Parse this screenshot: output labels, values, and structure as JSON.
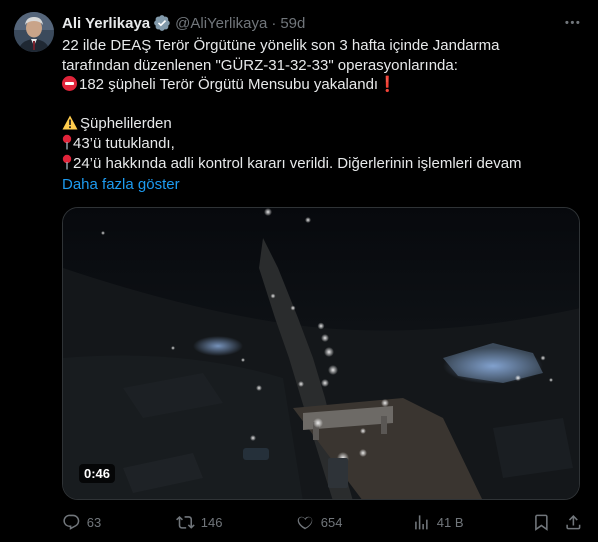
{
  "author": {
    "name": "Ali Yerlikaya",
    "handle": "@AliYerlikaya",
    "separator": "·",
    "time": "59d"
  },
  "tweet": {
    "line1": "22 ilde DEAŞ Terör Örgütüne yönelik son 3 hafta içinde Jandarma",
    "line2": "tarafından düzenlenen \"GÜRZ-31-32-33\" operasyonlarında:",
    "line3": "182 şüpheli Terör Örgütü Mensubu yakalandı",
    "line3_end": "❗",
    "line5": "Şüphelilerden",
    "line6": "43’ü tutuklandı,",
    "line7": "24’ü hakkında adli kontrol kararı verildi. Diğerlerinin işlemleri devam",
    "show_more": "Daha fazla göster"
  },
  "media": {
    "duration": "0:46"
  },
  "actions": {
    "replies": "63",
    "reposts": "146",
    "likes": "654",
    "views": "41 B"
  },
  "colors": {
    "background": "#000000",
    "text": "#e7e9ea",
    "muted": "#71767b",
    "link": "#1d9bf0",
    "verified": "#829aab",
    "border": "#2f3336"
  },
  "icons": [
    "avatar",
    "verified-badge-icon",
    "more-options-icon",
    "no-entry-emoji",
    "warning-emoji",
    "pin-emoji",
    "reply-icon",
    "repost-icon",
    "like-icon",
    "views-icon",
    "bookmark-icon",
    "share-icon"
  ]
}
